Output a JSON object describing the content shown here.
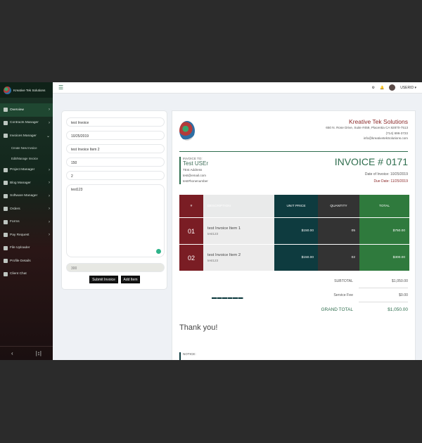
{
  "sidebar": {
    "brand": "Kreative Tek Solutions",
    "items": [
      {
        "label": "Overview",
        "icon": "home-icon",
        "active": true
      },
      {
        "label": "Contracts Manager",
        "icon": "contract-icon"
      },
      {
        "label": "Invoices Manager",
        "icon": "list-icon"
      },
      {
        "label": "Project Manager",
        "icon": "folder-icon"
      },
      {
        "label": "Blog Manager",
        "icon": "image-icon"
      },
      {
        "label": "Software Manager",
        "icon": "code-icon"
      },
      {
        "label": "Orders",
        "icon": "orders-icon"
      },
      {
        "label": "Forms",
        "icon": "forms-icon"
      },
      {
        "label": "Pay Request",
        "icon": "pay-icon"
      },
      {
        "label": "File Uploader",
        "icon": "upload-icon"
      },
      {
        "label": "Profile Details",
        "icon": "user-icon"
      },
      {
        "label": "Client Chat",
        "icon": "chat-icon"
      }
    ],
    "sub_items": [
      "Create New Invoice",
      "Edit/Manage Invoice"
    ],
    "footer": {
      "left": "‹",
      "right": "|↕|"
    }
  },
  "topbar": {
    "user": "USERID ▾",
    "gear": "⚙",
    "bell": "🔔"
  },
  "form": {
    "title": "test Invoice",
    "date": "10/25/2019",
    "item_name": "test Invoice Item 2",
    "price": "150",
    "qty": "2",
    "description": "test123",
    "total": "300",
    "submit_label": "Submit Invoice",
    "add_label": "Add Item"
  },
  "invoice": {
    "company": {
      "name": "Kreative Tek Solutions",
      "address": "650 N. Rose Drive, Suite #459, Placentia CA 92870-7513",
      "phone": "(714) 696-3723",
      "email": "info@kreativetekSolutions.com"
    },
    "to": {
      "label": "INVOICE TO:",
      "name": "Test USEr",
      "address": "TEst Address",
      "email": "test@email.com",
      "phone": "test#honenumber"
    },
    "number": "INVOICE # 0171",
    "date_label": "Date of Invoice: 10/25/2019",
    "due_label": "Due Date: 11/25/2019",
    "headers": {
      "num": "#",
      "desc": "DESCRIPTION",
      "price": "UNIT PRICE",
      "qty": "QUANTITY",
      "total": "TOTAL"
    },
    "rows": [
      {
        "num": "01",
        "title": "test Invoice Item 1",
        "sub": "test123",
        "price": "$150.00",
        "qty": "05",
        "total": "$750.00"
      },
      {
        "num": "02",
        "title": "test Invoice Item 2",
        "sub": "test123",
        "price": "$150.00",
        "qty": "02",
        "total": "$300.00"
      }
    ],
    "subtotal_label": "SUBTOTAL",
    "subtotal": "$1,050.00",
    "fee_label": "Service Fee",
    "fee": "$0.00",
    "grand_label": "GRAND TOTAL",
    "grand": "$1,050.00",
    "dashes": "▬▬▬▬▬▬",
    "thanks": "Thank you!",
    "notice_label": "NOTICE:"
  }
}
